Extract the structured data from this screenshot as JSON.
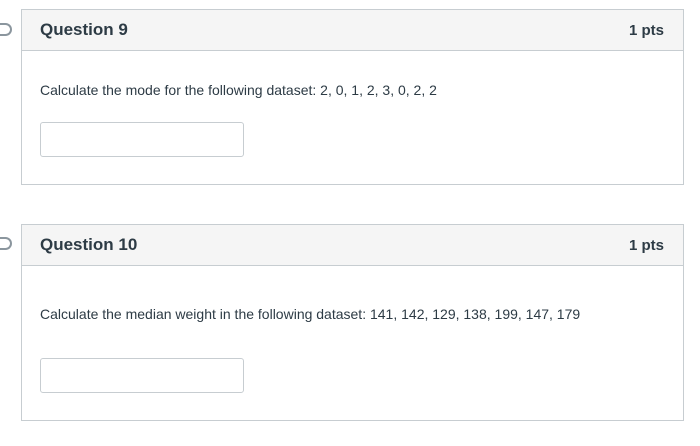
{
  "questions": [
    {
      "title": "Question 9",
      "points": "1 pts",
      "text": "Calculate the mode for the following dataset: 2, 0, 1, 2, 3, 0, 2, 2",
      "answer_value": ""
    },
    {
      "title": "Question 10",
      "points": "1 pts",
      "text": "Calculate the median weight in the following dataset: 141, 142, 129, 138, 199, 147, 179",
      "answer_value": ""
    }
  ]
}
